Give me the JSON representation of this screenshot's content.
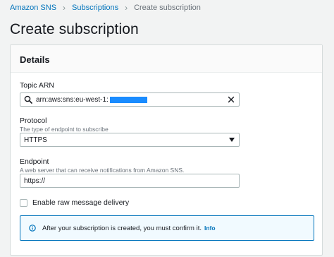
{
  "breadcrumb": {
    "items": [
      "Amazon SNS",
      "Subscriptions"
    ],
    "current": "Create subscription"
  },
  "page_title": "Create subscription",
  "details": {
    "header": "Details",
    "topic_arn": {
      "label": "Topic ARN",
      "value": "arn:aws:sns:eu-west-1:",
      "icon": "search-icon",
      "clear_icon": "close-icon"
    },
    "protocol": {
      "label": "Protocol",
      "description": "The type of endpoint to subscribe",
      "selected": "HTTPS"
    },
    "endpoint": {
      "label": "Endpoint",
      "description": "A web server that can receive notifications from Amazon SNS.",
      "value": "https://"
    },
    "raw_delivery": {
      "label": "Enable raw message delivery",
      "checked": false
    },
    "alert": {
      "text": "After your subscription is created, you must confirm it.",
      "link": "Info",
      "icon": "info-icon"
    }
  },
  "colors": {
    "link": "#0073bb",
    "redaction": "#1a8cff",
    "alert_bg": "#f1faff"
  }
}
